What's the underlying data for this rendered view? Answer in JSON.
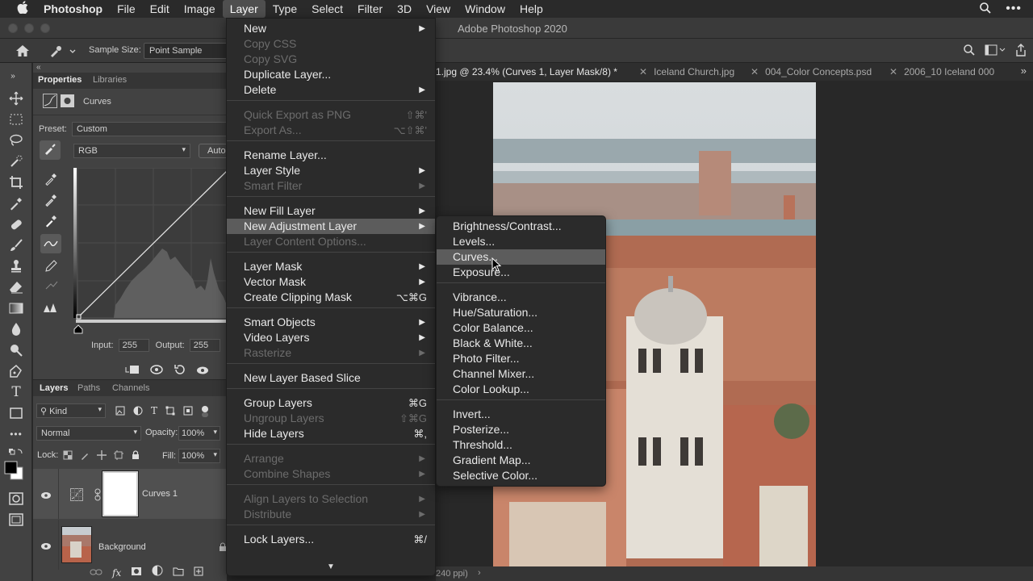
{
  "menubar": {
    "app_name": "Photoshop",
    "items": [
      "File",
      "Edit",
      "Image",
      "Layer",
      "Type",
      "Select",
      "Filter",
      "3D",
      "View",
      "Window",
      "Help"
    ],
    "active_item": "Layer"
  },
  "window": {
    "title": "Adobe Photoshop 2020"
  },
  "options_bar": {
    "sample_size_label": "Sample Size:",
    "sample_size_value": "Point Sample"
  },
  "doc_tabs": [
    {
      "label": "1.jpg @ 23.4% (Curves 1, Layer Mask/8) *",
      "active": true
    },
    {
      "label": "Iceland Church.jpg",
      "active": false
    },
    {
      "label": "004_Color Concepts.psd",
      "active": false
    },
    {
      "label": "2006_10 Iceland 000",
      "active": false
    }
  ],
  "properties": {
    "tab_active": "Properties",
    "tab_other": "Libraries",
    "title": "Curves",
    "preset_label": "Preset:",
    "preset_value": "Custom",
    "channel_value": "RGB",
    "auto_label": "Auto",
    "input_label": "Input:",
    "input_value": "255",
    "output_label": "Output:",
    "output_value": "255"
  },
  "layers_panel": {
    "tabs": [
      "Layers",
      "Paths",
      "Channels"
    ],
    "filter_label": "Kind",
    "blend_mode": "Normal",
    "opacity_label": "Opacity:",
    "opacity_value": "100%",
    "lock_label": "Lock:",
    "fill_label": "Fill:",
    "fill_value": "100%",
    "layers": [
      {
        "name": "Curves 1",
        "selected": true
      },
      {
        "name": "Background",
        "selected": false
      }
    ]
  },
  "layer_menu": {
    "items": [
      {
        "label": "New",
        "submenu": true
      },
      {
        "label": "Copy CSS",
        "disabled": true
      },
      {
        "label": "Copy SVG",
        "disabled": true
      },
      {
        "label": "Duplicate Layer..."
      },
      {
        "label": "Delete",
        "submenu": true
      },
      {
        "label": "Quick Export as PNG",
        "disabled": true,
        "shortcut": "⇧⌘'"
      },
      {
        "label": "Export As...",
        "disabled": true,
        "shortcut": "⌥⇧⌘'"
      },
      {
        "label": "Rename Layer..."
      },
      {
        "label": "Layer Style",
        "submenu": true
      },
      {
        "label": "Smart Filter",
        "disabled": true,
        "submenu": true
      },
      {
        "label": "New Fill Layer",
        "submenu": true
      },
      {
        "label": "New Adjustment Layer",
        "submenu": true,
        "highlighted": true
      },
      {
        "label": "Layer Content Options...",
        "disabled": true
      },
      {
        "label": "Layer Mask",
        "submenu": true
      },
      {
        "label": "Vector Mask",
        "submenu": true
      },
      {
        "label": "Create Clipping Mask",
        "shortcut": "⌥⌘G"
      },
      {
        "label": "Smart Objects",
        "submenu": true
      },
      {
        "label": "Video Layers",
        "submenu": true
      },
      {
        "label": "Rasterize",
        "disabled": true,
        "submenu": true
      },
      {
        "label": "New Layer Based Slice"
      },
      {
        "label": "Group Layers",
        "shortcut": "⌘G"
      },
      {
        "label": "Ungroup Layers",
        "disabled": true,
        "shortcut": "⇧⌘G"
      },
      {
        "label": "Hide Layers",
        "shortcut": "⌘,"
      },
      {
        "label": "Arrange",
        "disabled": true,
        "submenu": true
      },
      {
        "label": "Combine Shapes",
        "disabled": true,
        "submenu": true
      },
      {
        "label": "Align Layers to Selection",
        "disabled": true,
        "submenu": true
      },
      {
        "label": "Distribute",
        "disabled": true,
        "submenu": true
      },
      {
        "label": "Lock Layers...",
        "shortcut": "⌘/"
      }
    ]
  },
  "adjustment_submenu": {
    "items": [
      "Brightness/Contrast...",
      "Levels...",
      "Curves...",
      "Exposure...",
      "Vibrance...",
      "Hue/Saturation...",
      "Color Balance...",
      "Black & White...",
      "Photo Filter...",
      "Channel Mixer...",
      "Color Lookup...",
      "Invert...",
      "Posterize...",
      "Threshold...",
      "Gradient Map...",
      "Selective Color..."
    ],
    "highlighted": "Curves..."
  },
  "status_bar": {
    "text": "240 ppi)"
  },
  "colors": {
    "menu_bg": "#2b2b2b",
    "menu_highlight": "#5c5c5c",
    "panel_bg": "#424242"
  }
}
